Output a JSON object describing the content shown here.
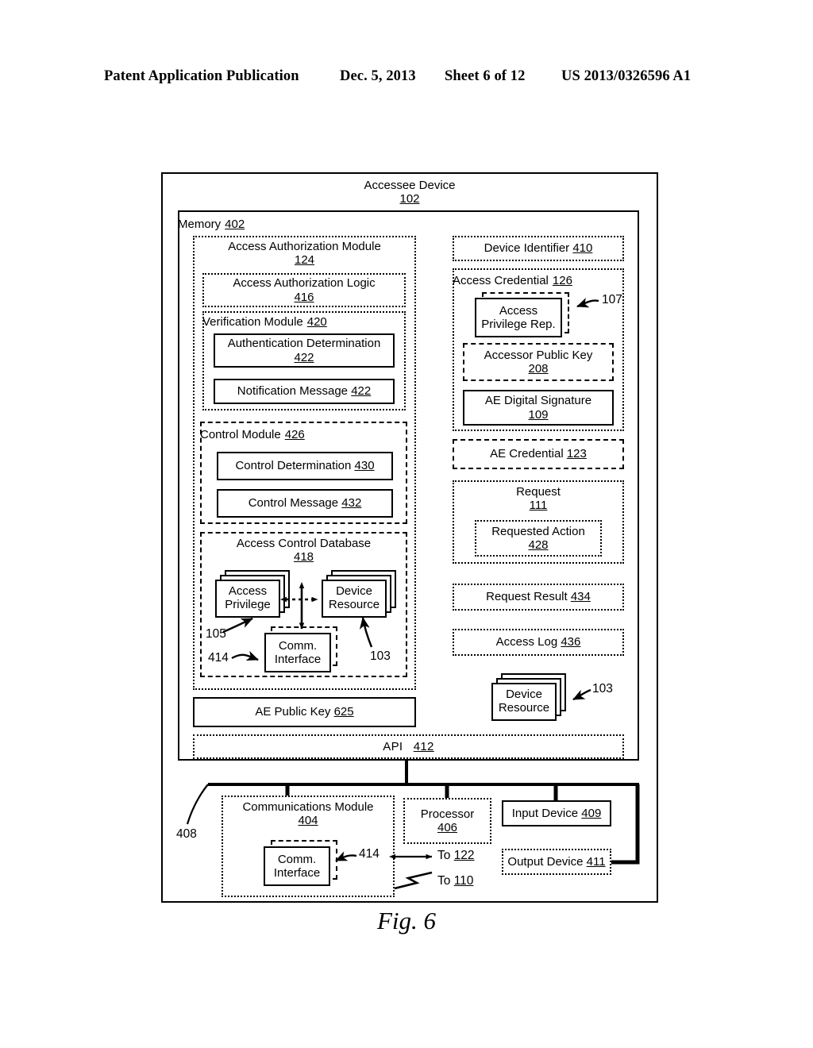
{
  "header": {
    "publication": "Patent Application Publication",
    "date": "Dec. 5, 2013",
    "sheet": "Sheet 6 of 12",
    "docnum": "US 2013/0326596 A1"
  },
  "figure": {
    "caption": "Fig. 6"
  },
  "device": {
    "title": "Accessee Device",
    "ref": "102"
  },
  "memory": {
    "title": "Memory",
    "ref": "402"
  },
  "left": {
    "aam": {
      "title": "Access Authorization Module",
      "ref": "124"
    },
    "aal": {
      "title": "Access Authorization Logic",
      "ref": "416"
    },
    "verification": {
      "title": "Verification Module",
      "ref": "420"
    },
    "auth_det": {
      "title": "Authentication Determination",
      "ref": "422"
    },
    "notif_msg": {
      "title": "Notification Message",
      "ref": "422"
    },
    "control_module": {
      "title": "Control Module",
      "ref": "426"
    },
    "control_det": {
      "title": "Control Determination",
      "ref": "430"
    },
    "control_msg": {
      "title": "Control Message",
      "ref": "432"
    },
    "acdb": {
      "title": "Access Control Database",
      "ref": "418"
    },
    "access_privilege": {
      "title": "Access Privilege",
      "ref": "105"
    },
    "device_resource": {
      "title": "Device Resource",
      "ref": "103"
    },
    "comm_interface": {
      "title": "Comm. Interface",
      "ref": "414"
    },
    "ae_public_key": {
      "title": "AE Public Key",
      "ref": "625"
    }
  },
  "right": {
    "device_identifier": {
      "title": "Device Identifier",
      "ref": "410"
    },
    "access_credential": {
      "title": "Access Credential",
      "ref": "126"
    },
    "access_privilege_rep": {
      "title": "Access Privilege Rep.",
      "ref": "107"
    },
    "accessor_public_key": {
      "title": "Accessor Public Key",
      "ref": "208"
    },
    "ae_digital_signature": {
      "title": "AE Digital Signature",
      "ref": "109"
    },
    "ae_credential": {
      "title": "AE Credential",
      "ref": "123"
    },
    "request": {
      "title": "Request",
      "ref": "111"
    },
    "requested_action": {
      "title": "Requested Action",
      "ref": "428"
    },
    "request_result": {
      "title": "Request Result",
      "ref": "434"
    },
    "access_log": {
      "title": "Access Log",
      "ref": "436"
    },
    "device_resource": {
      "title": "Device Resource",
      "ref": "103"
    }
  },
  "api": {
    "title": "API",
    "ref": "412"
  },
  "bus": {
    "ref": "408"
  },
  "hardware": {
    "comm_module": {
      "title": "Communications Module",
      "ref": "404"
    },
    "comm_interface": {
      "title": "Comm. Interface",
      "ref": "414"
    },
    "processor": {
      "title": "Processor",
      "ref": "406"
    },
    "input_device": {
      "title": "Input Device",
      "ref": "409"
    },
    "output_device": {
      "title": "Output Device",
      "ref": "411"
    },
    "to_122": {
      "label": "To",
      "ref": "122"
    },
    "to_110": {
      "label": "To",
      "ref": "110"
    }
  }
}
